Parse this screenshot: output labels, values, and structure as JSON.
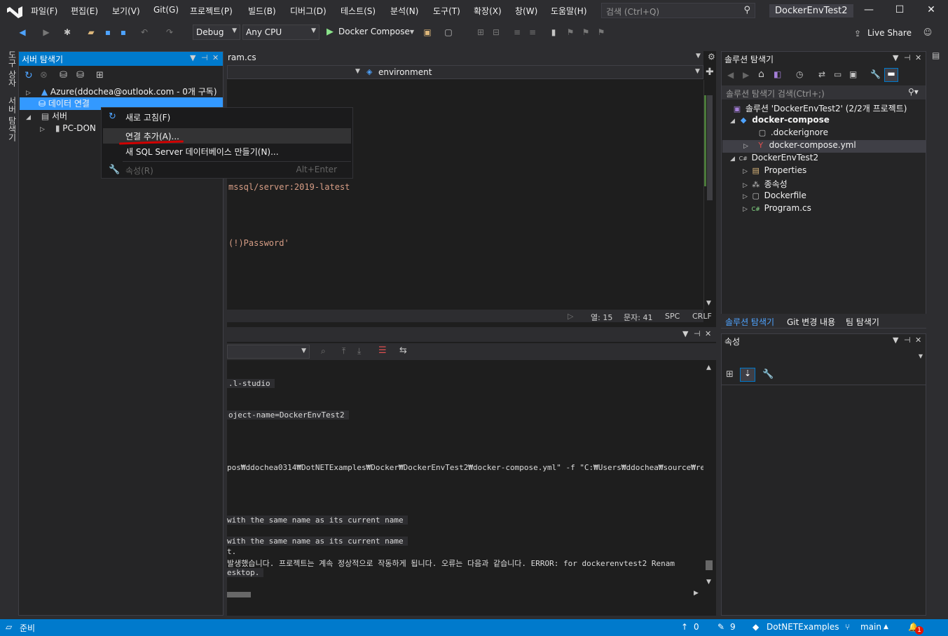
{
  "menubar": {
    "items": [
      "파일(F)",
      "편집(E)",
      "보기(V)",
      "Git(G)",
      "프로젝트(P)",
      "빌드(B)",
      "디버그(D)",
      "테스트(S)",
      "분석(N)",
      "도구(T)",
      "확장(X)",
      "창(W)",
      "도움말(H)"
    ],
    "search_placeholder": "검색 (Ctrl+Q)",
    "app_title": "DockerEnvTest2"
  },
  "toolbar": {
    "config": "Debug",
    "platform": "Any CPU",
    "run_target": "Docker Compose",
    "live_share": "Live Share"
  },
  "left_tabs": [
    "도구 상자",
    "서버 탐색기"
  ],
  "server_explorer": {
    "title": "서버 탐색기",
    "items": [
      {
        "label": "Azure(ddochea@outlook.com - 0개 구독)",
        "expander": "▷"
      },
      {
        "label": "데이터 연결",
        "expander": ""
      },
      {
        "label": "서버",
        "expander": "◢"
      },
      {
        "label": "PC-DON",
        "expander": "▷"
      }
    ]
  },
  "context_menu": {
    "items": [
      {
        "label": "새로 고침(F)",
        "shortcut": ""
      },
      {
        "label": "연결 추가(A)...",
        "shortcut": ""
      },
      {
        "label": "새 SQL Server 데이터베이스 만들기(N)...",
        "shortcut": ""
      },
      {
        "label": "속성(R)",
        "shortcut": "Alt+Enter"
      }
    ]
  },
  "editor": {
    "tab": "ram.cs",
    "nav_right": "environment",
    "lines": [
      "mssql/server:2019-latest",
      "(!)Password'"
    ],
    "status": {
      "col": "열: 15",
      "char": "문자: 41",
      "spc": "SPC",
      "crlf": "CRLF"
    }
  },
  "output": {
    "lines": [
      ".l-studio",
      "oject-name=DockerEnvTest2",
      "pos₩ddochea0314₩DotNETExamples₩Docker₩DockerEnvTest2₩docker-compose.yml\" -f \"C:₩Users₩ddochea₩source₩repos₩ddochea",
      " with the same name as its current name",
      " with the same name as its current name",
      "t.",
      "발생했습니다. 프로젝트는 계속 정상적으로 작동하게 됩니다. 오류는 다음과 같습니다. ERROR: for dockerenvtest2  Renam",
      "esktop."
    ]
  },
  "solution_explorer": {
    "title": "솔루션 탐색기",
    "search_placeholder": "솔루션 탐색기 검색(Ctrl+;)",
    "items": [
      {
        "label": "솔루션 'DockerEnvTest2' (2/2개 프로젝트)",
        "icon": "▣",
        "expander": ""
      },
      {
        "label": "docker-compose",
        "icon": "◆",
        "expander": "◢"
      },
      {
        "label": ".dockerignore",
        "icon": "▢",
        "expander": ""
      },
      {
        "label": "docker-compose.yml",
        "icon": "Y",
        "expander": "▷"
      },
      {
        "label": "DockerEnvTest2",
        "icon": "C#",
        "expander": "◢"
      },
      {
        "label": "Properties",
        "icon": "▤",
        "expander": "▷"
      },
      {
        "label": "종속성",
        "icon": "⁂",
        "expander": "▷"
      },
      {
        "label": "Dockerfile",
        "icon": "▢",
        "expander": "▷"
      },
      {
        "label": "Program.cs",
        "icon": "C#",
        "expander": "▷"
      }
    ],
    "bottom_tabs": [
      "솔루션 탐색기",
      "Git 변경 내용",
      "팀 탐색기"
    ]
  },
  "properties": {
    "title": "속성"
  },
  "statusbar": {
    "ready": "준비",
    "up_count": "0",
    "pencil_count": "9",
    "repo": "DotNETExamples",
    "branch": "main",
    "notif_count": "1"
  }
}
